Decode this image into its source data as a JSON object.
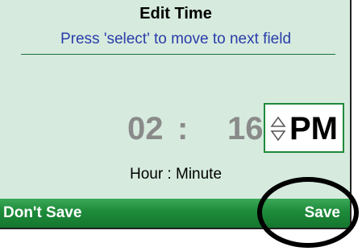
{
  "header": {
    "title": "Edit Time",
    "instruction": "Press 'select' to move to next field"
  },
  "time": {
    "hour": "02",
    "separator": ":",
    "minute": "16",
    "meridiem": "PM",
    "field_label": "Hour : Minute"
  },
  "softkeys": {
    "left_label": "Don't Save",
    "right_label": "Save"
  },
  "icons": {
    "meridiem_toggle": "up-down-arrows-icon"
  },
  "colors": {
    "screen_bg": "#d6ebde",
    "accent_green": "#1d8a3a",
    "instruction_blue": "#2a3ca8",
    "time_gray": "#8a8a8a"
  }
}
